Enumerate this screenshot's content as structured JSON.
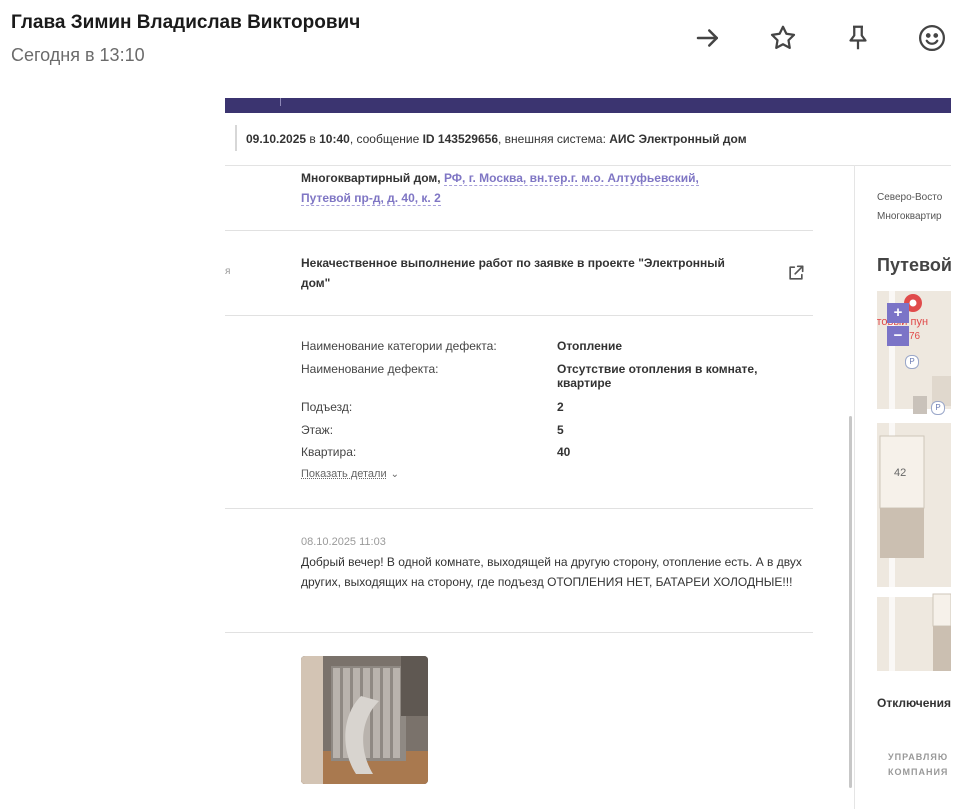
{
  "header": {
    "sender": "Глава Зимин Владислав Викторович",
    "time": "Сегодня в 13:10",
    "icons": [
      "arrow-right-icon",
      "star-icon",
      "pin-icon",
      "emoji-icon"
    ]
  },
  "ticket": {
    "date": "09.10.2025",
    "at": " в ",
    "time": "10:40",
    "msg_prefix": ", сообщение ",
    "id": "ID 143529656",
    "sys_prefix": ", внешняя система: ",
    "system": "АИС Электронный дом",
    "address_prefix": "Многоквартирный дом, ",
    "address_line1": "РФ, г. Москва, вн.тер.г. м.о. Алтуфьевский,",
    "address_line2": "Путевой пр-д, д. 40, к. 2",
    "left_fragment": "я",
    "topic": "Некачественное выполнение работ по заявке в проекте \"Электронный дом\"",
    "fields": [
      {
        "label": "Наименование категории дефекта:",
        "value": "Отопление"
      },
      {
        "label": "Наименование дефекта:",
        "value": "Отсутствие отопления в комнате, квартире"
      },
      {
        "label": "Подъезд:",
        "value": "2"
      },
      {
        "label": "Этаж:",
        "value": "5"
      },
      {
        "label": "Квартира:",
        "value": "40"
      }
    ],
    "show_details": "Показать детали",
    "comment_time": "08.10.2025 11:03",
    "comment_text": "Добрый вечер! В одной комнате, выходящей на другую сторону, отопление есть. А в двух других, выходящих на сторону, где подъезд ОТОПЛЕНИЯ НЕТ, БАТАРЕИ ХОЛОДНЫЕ!!!"
  },
  "side": {
    "line1": "Северо-Восто",
    "line2": "Многоквартир",
    "title": "Путевой",
    "map_label_top": "стовый пун",
    "map_label_num": "76",
    "map_building": "42",
    "map_parking": "P",
    "zoom_in": "+",
    "zoom_out": "−",
    "outages": "Отключения",
    "caps1": "УПРАВЛЯЮ",
    "caps2": "КОМПАНИЯ"
  },
  "colors": {
    "topbar": "#3b3470",
    "link": "#7f76c4",
    "zoom": "#7b74c7"
  }
}
